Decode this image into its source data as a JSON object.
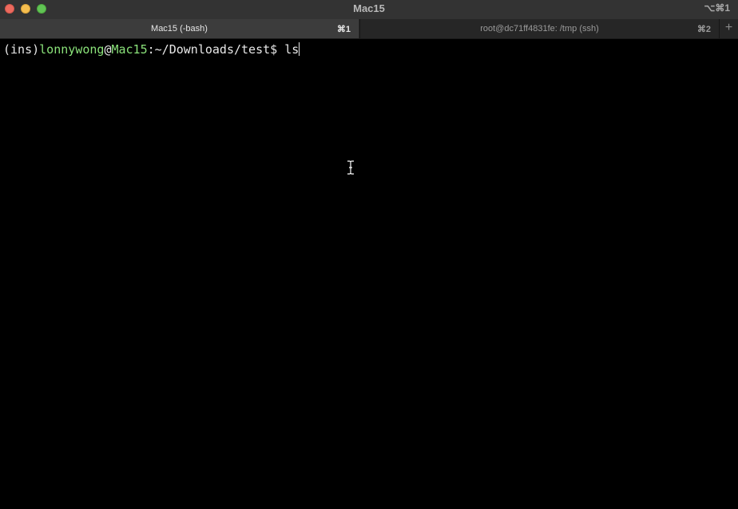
{
  "window": {
    "title": "Mac15",
    "shortcut": "⌥⌘1"
  },
  "tabs": [
    {
      "label": "Mac15 (-bash)",
      "shortcut": "⌘1",
      "active": true
    },
    {
      "label": "root@dc71ff4831fe: /tmp (ssh)",
      "shortcut": "⌘2",
      "active": false
    }
  ],
  "new_tab_label": "+",
  "terminal": {
    "prompt": {
      "env": "(ins)",
      "user": "lonnywong",
      "at": "@",
      "host": "Mac15",
      "path": ":~/Downloads/test$ ",
      "command": "ls"
    }
  },
  "colors": {
    "prompt_green": "#8be37a",
    "background": "#000000",
    "text": "#e8e8e8"
  }
}
